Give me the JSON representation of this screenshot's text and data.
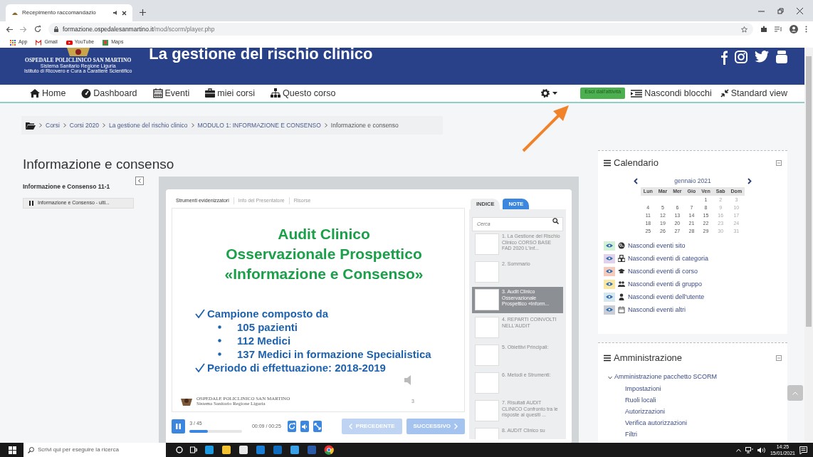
{
  "browser": {
    "tab_title": "Recepimento raccomandazio",
    "address_host": "formazione.ospedalesanmartino.it",
    "address_path": "/mod/scorm/player.php",
    "bookmarks": [
      {
        "label": "App",
        "kind": "apps"
      },
      {
        "label": "Gmail",
        "kind": "gmail"
      },
      {
        "label": "YouTube",
        "kind": "youtube"
      },
      {
        "label": "Maps",
        "kind": "maps"
      }
    ]
  },
  "header": {
    "site_title": "La gestione del rischio clinico",
    "logo_lines": [
      "OSPEDALE POLICLINICO SAN MARTINO",
      "Sistema Sanitario Regione Liguria",
      "Istituto di Ricovero e Cura a Carattere Scientifico"
    ]
  },
  "nav": {
    "items": [
      {
        "label": "Home",
        "kind": "home"
      },
      {
        "label": "Dashboard",
        "kind": "dashboard"
      },
      {
        "label": "Eventi",
        "kind": "calendar"
      },
      {
        "label": "miei corsi",
        "kind": "briefcase"
      },
      {
        "label": "Questo corso",
        "kind": "sitemap"
      }
    ],
    "exit_button": "Esci dall'attività",
    "hide_blocks": "Nascondi blocchi",
    "standard_view": "Standard view"
  },
  "breadcrumb": [
    "Corsi",
    "Corsi 2020",
    "La gestione del rischio clinico",
    "MODULO 1: INFORMAZIONE E CONSENSO",
    "Informazione e consenso"
  ],
  "page_title": "Informazione e consenso",
  "toc": {
    "title": "Informazione e Consenso 11-1",
    "items": [
      {
        "label": "Informazione e Consenso - ulti..."
      }
    ]
  },
  "player": {
    "tabs": [
      {
        "label": "Strumenti evidenizzatori",
        "selected": true
      },
      {
        "label": "Info del Presentatore",
        "selected": false
      },
      {
        "label": "Risorse",
        "selected": false
      }
    ],
    "slide": {
      "title_lines": [
        "Audit Clinico",
        "Osservazionale Prospettico",
        "«Informazione e Consenso»"
      ],
      "bullets": [
        {
          "text": "Campione composto da",
          "kind": "check"
        },
        {
          "text": "105 pazienti",
          "kind": "dot"
        },
        {
          "text": "112 Medici",
          "kind": "dot"
        },
        {
          "text": "137 Medici in formazione Specialistica",
          "kind": "dot"
        },
        {
          "text": "Periodo di effettuazione: 2018-2019",
          "kind": "check"
        }
      ],
      "footer_lines": [
        "OSPEDALE POLICLINICO SAN MARTINO",
        "Sistema Sanitario Regione Liguria"
      ],
      "page_number": "3"
    },
    "controls": {
      "playing": true,
      "counter": "3 / 45",
      "level": 0.35,
      "time": "00:09 / 00:25",
      "previous": {
        "label": "PRECEDENTE",
        "disabled": true
      },
      "next": {
        "label": "SUCCESSIVO",
        "disabled": false
      }
    },
    "side_tabs": [
      {
        "label": "INDICE",
        "selected": false
      },
      {
        "label": "NOTE",
        "selected": true
      }
    ],
    "search_placeholder": "Cerca",
    "slides": [
      {
        "label": "1. La Gestione del Rischio Clinico CORSO BASE FAD 2020 L'Inf...",
        "selected": false
      },
      {
        "label": "2. Sommario",
        "selected": false
      },
      {
        "label": "3. Audit Clinico Osservazionale Prospettico «Inform...",
        "selected": true
      },
      {
        "label": "4. REPARTI COINVOLTI NELL'AUDIT",
        "selected": false
      },
      {
        "label": "5. Obiettivi Principali:",
        "selected": false
      },
      {
        "label": "6. Metodi e Strumenti:",
        "selected": false
      },
      {
        "label": "7. Risultati AUDIT CLINICO Confronto tra le risposte ai quesiti ...",
        "selected": false
      },
      {
        "label": "8. AUDIT Clinico su",
        "selected": false
      }
    ]
  },
  "calendar": {
    "title": "Calendario",
    "month": "gennaio 2021",
    "weekdays": [
      "Lun",
      "Mar",
      "Mer",
      "Gio",
      "Ven",
      "Sab",
      "Dom"
    ],
    "weeks": [
      [
        "1",
        "2",
        "3"
      ],
      [
        "4",
        "5",
        "6",
        "7",
        "8",
        "9",
        "10"
      ],
      [
        "11",
        "12",
        "13",
        "14",
        "15",
        "16",
        "17"
      ],
      [
        "18",
        "19",
        "20",
        "21",
        "22",
        "23",
        "24"
      ],
      [
        "25",
        "26",
        "27",
        "28",
        "29",
        "30",
        "31"
      ]
    ],
    "filters": [
      {
        "label": "Nascondi eventi sito",
        "kind": "site",
        "color": "#d3f1d6"
      },
      {
        "label": "Nascondi eventi di categoria",
        "kind": "category",
        "color": "#e3d3ea"
      },
      {
        "label": "Nascondi eventi di corso",
        "kind": "course",
        "color": "#f7cbbb"
      },
      {
        "label": "Nascondi eventi di gruppo",
        "kind": "group",
        "color": "#fbe7a4"
      },
      {
        "label": "Nascondi eventi dell'utente",
        "kind": "user",
        "color": "#d7e7ef"
      },
      {
        "label": "Nascondi eventi altri",
        "kind": "other",
        "color": "#c9ced6"
      }
    ]
  },
  "admin": {
    "title": "Amministrazione",
    "sections": [
      {
        "label": "Amministrazione pacchetto SCORM",
        "expanded": true,
        "children": [
          {
            "label": "Impostazioni"
          },
          {
            "label": "Ruoli locali"
          },
          {
            "label": "Autorizzazioni"
          },
          {
            "label": "Verifica autorizzazioni"
          },
          {
            "label": "Filtri"
          }
        ]
      }
    ]
  },
  "taskbar": {
    "search_placeholder": "Scrivi qui per eseguire la ricerca",
    "time": "14:25",
    "date": "15/01/2021"
  }
}
